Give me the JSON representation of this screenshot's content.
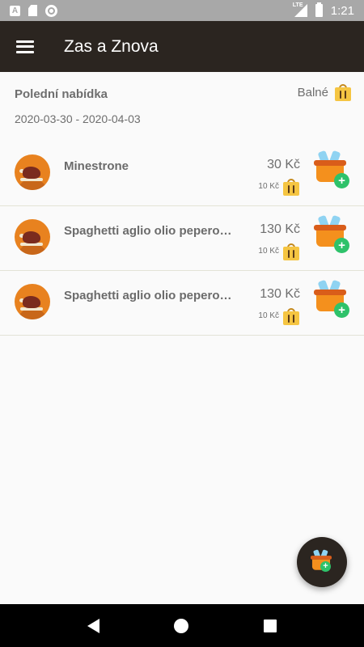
{
  "status_bar": {
    "time": "1:21",
    "network": "LTE"
  },
  "app_bar": {
    "title": "Zas a Znova"
  },
  "menu": {
    "title": "Polední nabídka",
    "dates": "2020-03-30 - 2020-04-03",
    "packaging_label": "Balné"
  },
  "items": [
    {
      "name": "Minestrone",
      "price": "30 Kč",
      "packaging_price": "10 Kč"
    },
    {
      "name": "Spaghetti aglio olio peperoncino",
      "price": "130 Kč",
      "packaging_price": "10 Kč"
    },
    {
      "name": "Spaghetti aglio olio peperoncino",
      "price": "130 Kč",
      "packaging_price": "10 Kč"
    }
  ],
  "fab": {
    "icon": "basket-add-icon"
  },
  "colors": {
    "app_bar": "#2b2520",
    "accent_orange": "#e8821f",
    "plus_green": "#2ec26a",
    "bag_yellow": "#f5c542"
  }
}
